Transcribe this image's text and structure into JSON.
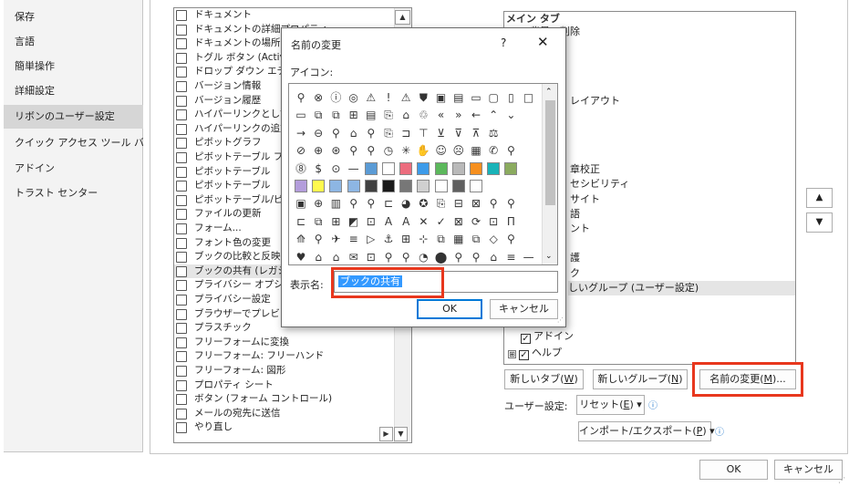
{
  "nav": {
    "items": [
      {
        "label": "保存",
        "active": false
      },
      {
        "label": "言語",
        "active": false
      },
      {
        "label": "簡単操作",
        "active": false
      },
      {
        "label": "詳細設定",
        "active": false
      },
      {
        "label": "リボンのユーザー設定",
        "active": true
      },
      {
        "label": "クイック アクセス ツール バー",
        "active": false
      },
      {
        "label": "アドイン",
        "active": false
      },
      {
        "label": "トラスト センター",
        "active": false
      }
    ]
  },
  "commands": {
    "items": [
      {
        "label": "ドキュメント",
        "icon": "document-icon"
      },
      {
        "label": "ドキュメントの詳細プロパティ",
        "icon": "properties-icon"
      },
      {
        "label": "ドキュメントの場所",
        "icon": "location-icon"
      },
      {
        "label": "トグル ボタン (ActiveX コントロール)",
        "icon": "toggle-icon"
      },
      {
        "label": "ドロップ ダウン エディター",
        "icon": "dropdown-icon"
      },
      {
        "label": "バージョン情報",
        "icon": "info-icon"
      },
      {
        "label": "バージョン履歴",
        "icon": "history-icon"
      },
      {
        "label": "ハイパーリンクとして貼り付け",
        "icon": "hyperlink-icon"
      },
      {
        "label": "ハイパーリンクの追加",
        "icon": "link-add-icon"
      },
      {
        "label": "ピボットグラフ",
        "icon": "pivot-chart-icon"
      },
      {
        "label": "ピボットテーブル フィールド",
        "icon": "pivot-field-icon"
      },
      {
        "label": "ピボットテーブル",
        "icon": "pivot-table-icon"
      },
      {
        "label": "ピボットテーブル",
        "icon": "pivot-table-icon"
      },
      {
        "label": "ピボットテーブル/ピボットグラフ",
        "icon": "pivot-wizard-icon"
      },
      {
        "label": "ファイルの更新",
        "icon": "refresh-icon"
      },
      {
        "label": "フォーム...",
        "icon": "form-icon"
      },
      {
        "label": "フォント色の変更",
        "icon": "font-color-icon"
      },
      {
        "label": "ブックの比較と反映...",
        "icon": "compare-icon"
      },
      {
        "label": "ブックの共有 (レガシ)",
        "icon": "share-workbook-icon"
      },
      {
        "label": "プライバシー オプション",
        "icon": "privacy-options-icon"
      },
      {
        "label": "プライバシー設定",
        "icon": "privacy-settings-icon"
      },
      {
        "label": "ブラウザーでプレビュー",
        "icon": "browser-preview-icon"
      },
      {
        "label": "プラスチック",
        "icon": "plastic-icon"
      },
      {
        "label": "フリーフォームに変換",
        "icon": "freeform-convert-icon"
      },
      {
        "label": "フリーフォーム: フリーハンド",
        "icon": "freehand-icon"
      },
      {
        "label": "フリーフォーム: 図形",
        "icon": "freeform-shape-icon"
      },
      {
        "label": "プロパティ シート",
        "icon": "property-sheet-icon"
      },
      {
        "label": "ボタン (フォーム コントロール)",
        "icon": "button-control-icon"
      },
      {
        "label": "メールの宛先に送信",
        "icon": "mail-send-icon"
      },
      {
        "label": "やり直し",
        "icon": "redo-icon"
      }
    ],
    "selected_index": 18
  },
  "tree": {
    "header": "メイン タブ",
    "rows": [
      {
        "text": "背景の削除",
        "checked": true
      },
      {
        "text": "レイアウト"
      },
      {
        "text": "章校正"
      },
      {
        "text": "セシビリティ"
      },
      {
        "text": "サイト"
      },
      {
        "text": "語"
      },
      {
        "text": "ント"
      },
      {
        "text": "護"
      },
      {
        "text": "ク"
      },
      {
        "text": "しいグループ (ユーザー設定)"
      },
      {
        "text": "アドイン",
        "checked": true
      },
      {
        "text": "ヘルプ",
        "checked": true
      }
    ]
  },
  "buttons": {
    "new_tab": "新しいタブ(",
    "new_tab_key": "W",
    "new_group": "新しいグループ(",
    "new_group_key": "N",
    "rename": "名前の変更(",
    "rename_key": "M",
    "rename_suffix": ")...",
    "close_paren": ")",
    "user_settings_label": "ユーザー設定:",
    "reset": "リセット(",
    "reset_key": "E",
    "import_export": "インポート/エクスポート(",
    "import_export_key": "P",
    "ok": "OK",
    "cancel": "キャンセル",
    "arrow_up": "▲",
    "arrow_down": "▼"
  },
  "dialog": {
    "title": "名前の変更",
    "help": "?",
    "close": "✕",
    "icon_label": "アイコン:",
    "display_name_label": "表示名:",
    "display_name_value": "ブックの共有",
    "ok": "OK",
    "cancel": "キャンセル"
  },
  "colors": {
    "highlight": "#e8371d",
    "selection": "#3399ff",
    "active_nav": "#d6d6d6"
  }
}
